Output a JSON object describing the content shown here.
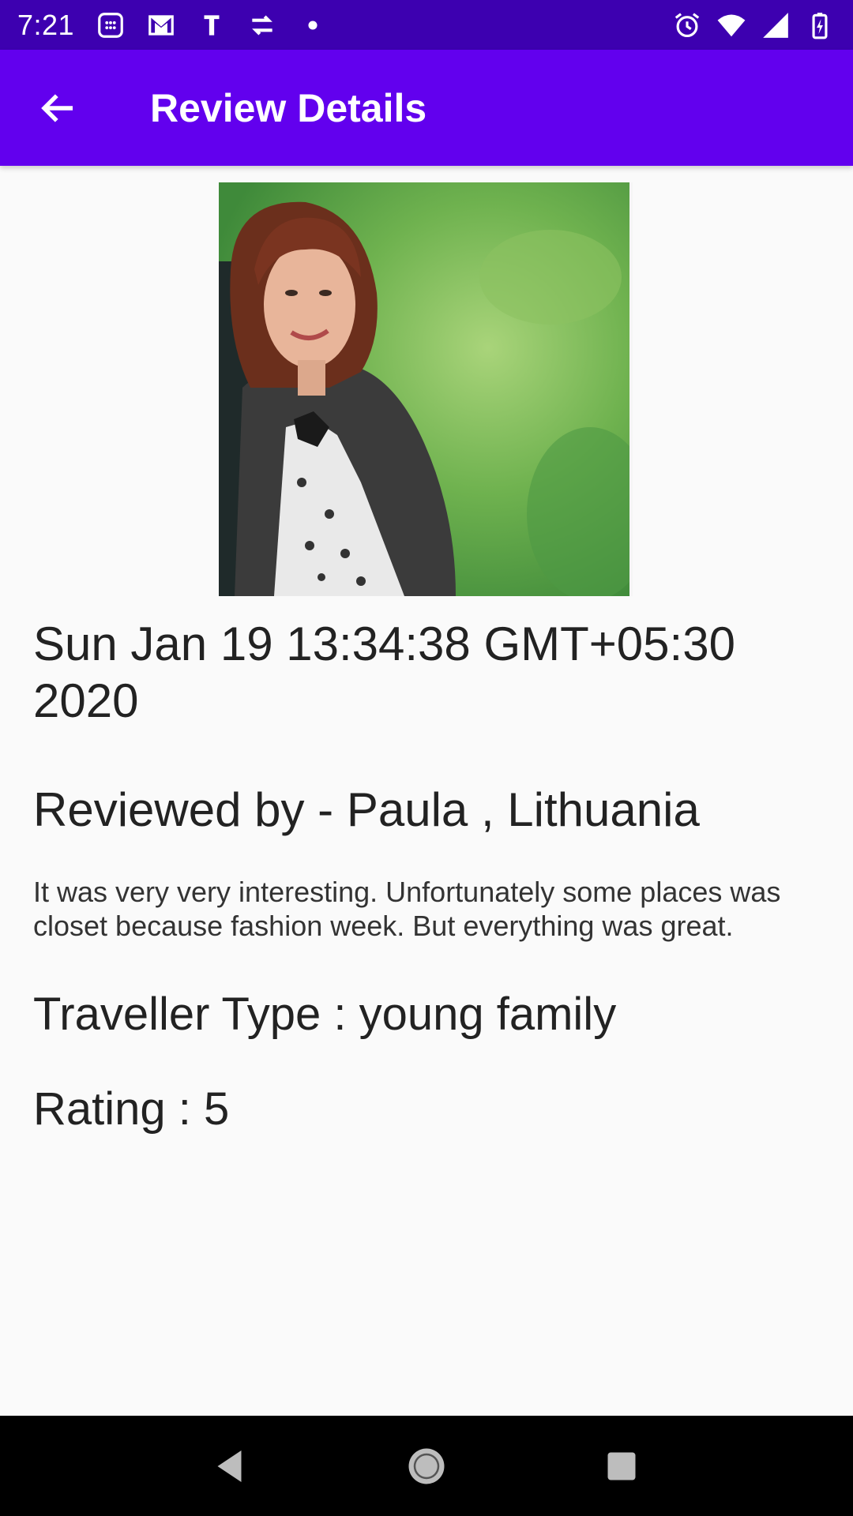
{
  "status_bar": {
    "time": "7:21",
    "left_icons": [
      "calendar-icon",
      "gmail-icon",
      "text-icon",
      "sync-icon",
      "dot-icon"
    ],
    "right_icons": [
      "alarm-icon",
      "wifi-icon",
      "signal-icon",
      "battery-icon"
    ]
  },
  "app_bar": {
    "title": "Review Details",
    "back_icon": "arrow-back-icon",
    "color": "#6200ee"
  },
  "review": {
    "photo_alt": "reviewer-photo",
    "date": "Sun Jan 19 13:34:38 GMT+05:30 2020",
    "reviewer": "Reviewed by - Paula , Lithuania",
    "body": "It was very very interesting. Unfortunately some places was closet because fashion week. But everything was great.",
    "traveller_type": "Traveller Type : young family",
    "rating": "Rating : 5"
  },
  "nav_bar": {
    "icons": [
      "back-triangle-icon",
      "home-circle-icon",
      "recents-square-icon"
    ]
  }
}
